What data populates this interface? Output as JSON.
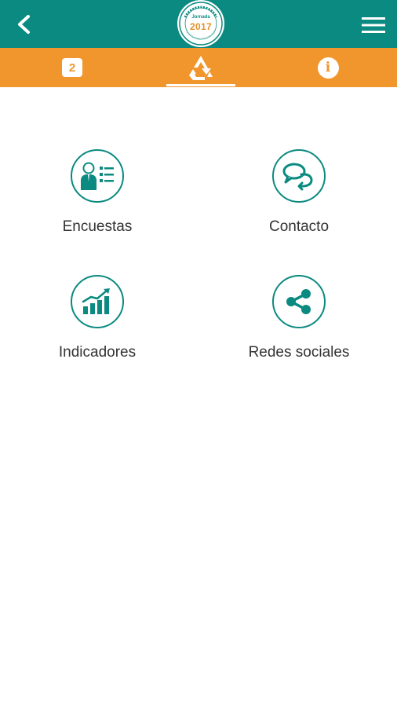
{
  "topbar": {
    "background": "#0a8a80",
    "back_icon": "chevron-left-icon",
    "menu_icon": "hamburger-menu-icon",
    "logo": {
      "year": "2017",
      "subtitle": "Jornada"
    }
  },
  "tabbar": {
    "background": "#f0962c",
    "tabs": [
      {
        "label": "2",
        "icon": "calendar-day-icon"
      },
      {
        "label": "",
        "icon": "recycle-triangle-icon",
        "selected": true
      },
      {
        "label": "i",
        "icon": "info-icon"
      }
    ]
  },
  "menu": {
    "accent": "#0a8a80",
    "items": [
      {
        "label": "Encuestas",
        "icon": "survey-person-list-icon"
      },
      {
        "label": "Contacto",
        "icon": "chat-bubbles-icon"
      },
      {
        "label": "Indicadores",
        "icon": "bar-chart-trend-icon"
      },
      {
        "label": "Redes sociales",
        "icon": "share-icon"
      }
    ]
  }
}
